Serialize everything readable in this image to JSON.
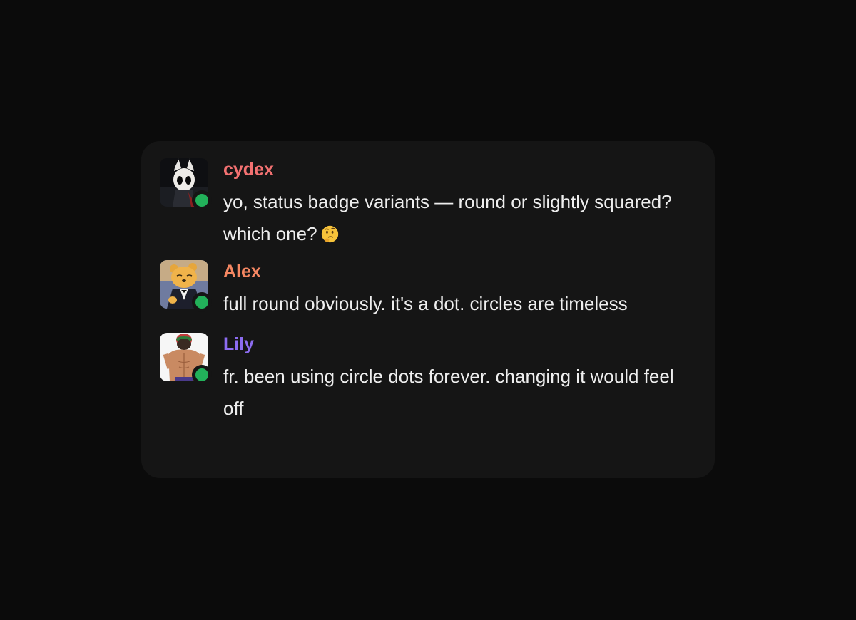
{
  "messages": [
    {
      "username": "cydex",
      "username_color": "#f27171",
      "text": "yo, status badge variants — round or slightly squared? which one?",
      "emoji": "thinking-face-icon",
      "status": "online"
    },
    {
      "username": "Alex",
      "username_color": "#f58762",
      "text": "full round obviously. it's a dot. circles are timeless",
      "status": "online"
    },
    {
      "username": "Lily",
      "username_color": "#8c6cf0",
      "text": "fr. been using circle dots forever. changing it would feel off",
      "status": "online"
    }
  ],
  "colors": {
    "background": "#0b0b0b",
    "card": "#151515",
    "status_online": "#22b15a",
    "text": "#eeeeee"
  }
}
